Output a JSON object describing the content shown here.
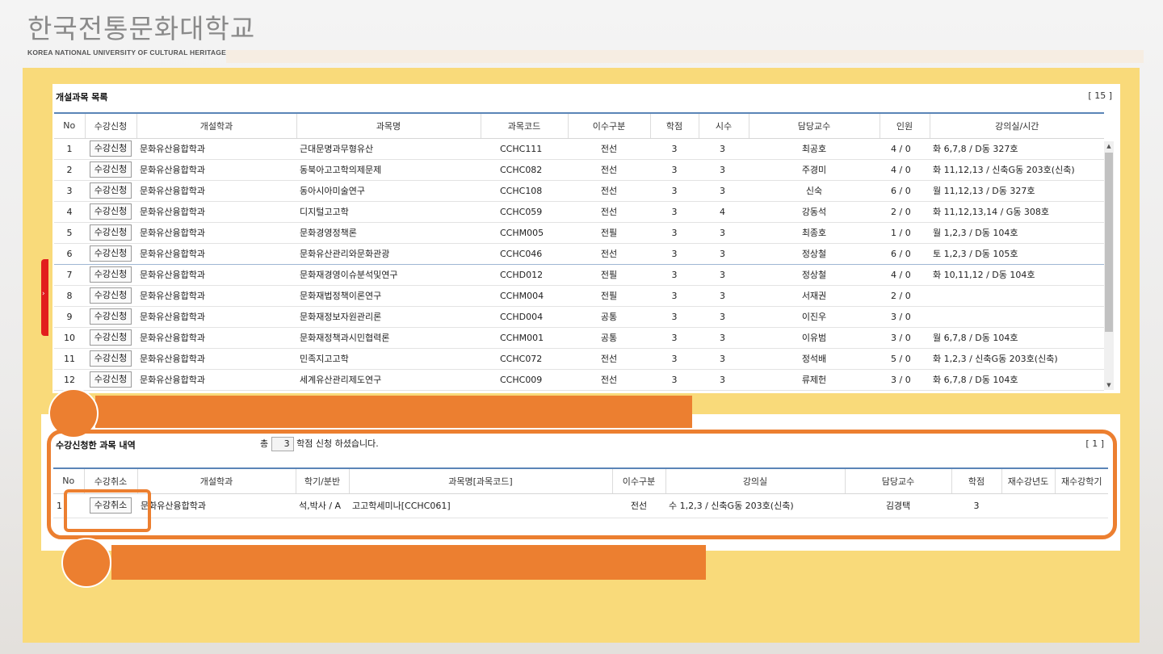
{
  "logo": {
    "korean": "한국전통문화대학교",
    "english": "KOREA NATIONAL UNIVERSITY OF CULTURAL HERITAGE"
  },
  "course_list": {
    "title": "개설과목 목록",
    "count": "[ 15 ]",
    "headers": [
      "No",
      "수강신청",
      "개설학과",
      "과목명",
      "과목코드",
      "이수구분",
      "학점",
      "시수",
      "담당교수",
      "인원",
      "강의실/시간"
    ],
    "enroll_label": "수강신청",
    "rows": [
      {
        "no": "1",
        "dept": "문화유산융합학과",
        "name": "근대문명과무형유산",
        "code": "CCHC111",
        "type": "전선",
        "credit": "3",
        "hours": "3",
        "prof": "최공호",
        "people": "4 / 0",
        "room": "화 6,7,8 / D동 327호"
      },
      {
        "no": "2",
        "dept": "문화유산융합학과",
        "name": "동북아고고학의제문제",
        "code": "CCHC082",
        "type": "전선",
        "credit": "3",
        "hours": "3",
        "prof": "주경미",
        "people": "4 / 0",
        "room": "화 11,12,13 / 신축G동 203호(신축)"
      },
      {
        "no": "3",
        "dept": "문화유산융합학과",
        "name": "동아시아미술연구",
        "code": "CCHC108",
        "type": "전선",
        "credit": "3",
        "hours": "3",
        "prof": "신숙",
        "people": "6 / 0",
        "room": "월 11,12,13 / D동 327호"
      },
      {
        "no": "4",
        "dept": "문화유산융합학과",
        "name": "디지털고고학",
        "code": "CCHC059",
        "type": "전선",
        "credit": "3",
        "hours": "4",
        "prof": "강동석",
        "people": "2 / 0",
        "room": "화 11,12,13,14 / G동 308호"
      },
      {
        "no": "5",
        "dept": "문화유산융합학과",
        "name": "문화경영정책론",
        "code": "CCHM005",
        "type": "전필",
        "credit": "3",
        "hours": "3",
        "prof": "최종호",
        "people": "1 / 0",
        "room": "월 1,2,3 / D동 104호"
      },
      {
        "no": "6",
        "dept": "문화유산융합학과",
        "name": "문화유산관리와문화관광",
        "code": "CCHC046",
        "type": "전선",
        "credit": "3",
        "hours": "3",
        "prof": "정상철",
        "people": "6 / 0",
        "room": "토 1,2,3 / D동 105호"
      },
      {
        "no": "7",
        "dept": "문화유산융합학과",
        "name": "문화재경영이슈분석및연구",
        "code": "CCHD012",
        "type": "전필",
        "credit": "3",
        "hours": "3",
        "prof": "정상철",
        "people": "4 / 0",
        "room": "화 10,11,12 / D동 104호"
      },
      {
        "no": "8",
        "dept": "문화유산융합학과",
        "name": "문화재법정책이론연구",
        "code": "CCHM004",
        "type": "전필",
        "credit": "3",
        "hours": "3",
        "prof": "서재권",
        "people": "2 / 0",
        "room": ""
      },
      {
        "no": "9",
        "dept": "문화유산융합학과",
        "name": "문화재정보자원관리론",
        "code": "CCHD004",
        "type": "공통",
        "credit": "3",
        "hours": "3",
        "prof": "이진우",
        "people": "3 / 0",
        "room": ""
      },
      {
        "no": "10",
        "dept": "문화유산융합학과",
        "name": "문화재정책과시민협력론",
        "code": "CCHM001",
        "type": "공통",
        "credit": "3",
        "hours": "3",
        "prof": "이유범",
        "people": "3 / 0",
        "room": "월 6,7,8 / D동 104호"
      },
      {
        "no": "11",
        "dept": "문화유산융합학과",
        "name": "민족지고고학",
        "code": "CCHC072",
        "type": "전선",
        "credit": "3",
        "hours": "3",
        "prof": "정석배",
        "people": "5 / 0",
        "room": "화 1,2,3 / 신축G동 203호(신축)"
      },
      {
        "no": "12",
        "dept": "문화유산융합학과",
        "name": "세계유산관리제도연구",
        "code": "CCHC009",
        "type": "전선",
        "credit": "3",
        "hours": "3",
        "prof": "류제헌",
        "people": "3 / 0",
        "room": "화 6,7,8 / D동 104호"
      }
    ]
  },
  "enrolled": {
    "title": "수강신청한 과목 내역",
    "total_prefix": "총",
    "total_credits": "3",
    "total_suffix": "학점 신청 하셨습니다.",
    "count": "[ 1 ]",
    "headers": [
      "No",
      "수강취소",
      "개설학과",
      "학기/분반",
      "과목명[과목코드]",
      "이수구분",
      "강의실",
      "담당교수",
      "학점",
      "재수강년도",
      "재수강학기"
    ],
    "cancel_label": "수강취소",
    "rows": [
      {
        "no": "1",
        "dept": "문화유산융합학과",
        "term": "석,박사 / A",
        "course": "고고학세미나[CCHC061]",
        "type": "전선",
        "room": "수 1,2,3 / 신축G동 203호(신축)",
        "prof": "김경택",
        "credit": "3",
        "retake_year": "",
        "retake_term": ""
      }
    ]
  },
  "colors": {
    "accent_orange": "#ec7f30",
    "background_yellow": "#f9da7a",
    "header_line_blue": "#5b85b7",
    "side_tab_red": "#e21d1d"
  }
}
